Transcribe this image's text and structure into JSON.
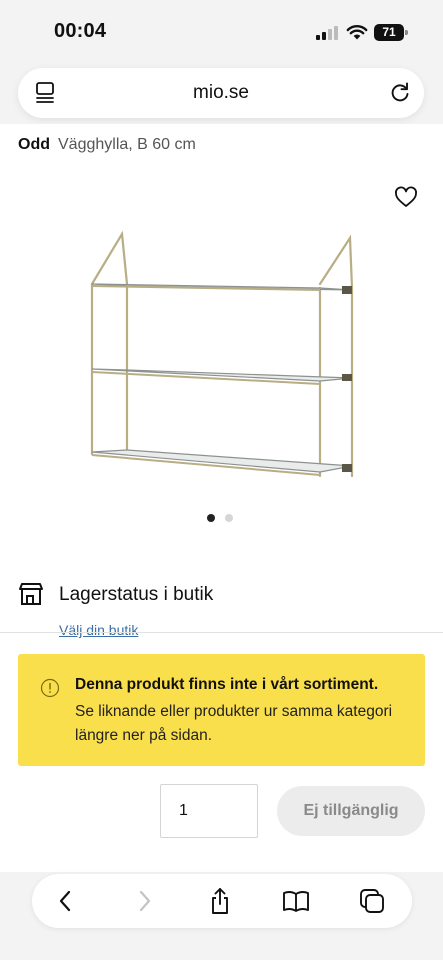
{
  "status_bar": {
    "time": "00:04",
    "battery": "71"
  },
  "browser": {
    "url": "mio.se"
  },
  "product": {
    "brand": "Odd",
    "name": "Vägghylla, B 60 cm"
  },
  "store": {
    "label": "Lagerstatus i butik",
    "choose_link": "Välj din butik"
  },
  "notice": {
    "title": "Denna produkt finns inte i vårt sortiment.",
    "body": "Se liknande eller produkter ur samma kategori längre ner på sidan."
  },
  "purchase": {
    "quantity": "1",
    "button_label": "Ej tillgänglig"
  },
  "colors": {
    "notice_bg": "#fadf4c",
    "link": "#3a6ea5",
    "disabled_button_bg": "#ececec"
  },
  "icons": [
    "tabs-overview-icon",
    "reload-icon",
    "heart-icon",
    "store-icon",
    "info-icon",
    "back-icon",
    "forward-icon",
    "share-icon",
    "bookmarks-icon",
    "tabs-icon"
  ]
}
